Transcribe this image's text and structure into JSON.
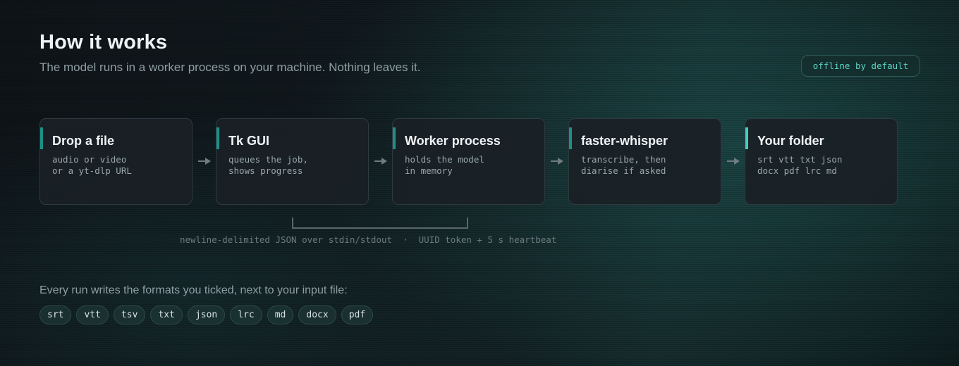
{
  "header": {
    "title": "How it works",
    "subtitle": "The model runs in a worker process on your machine. Nothing leaves it.",
    "badge": "offline by default"
  },
  "pipeline": {
    "steps": [
      {
        "title": "Drop a file",
        "description": "audio or video\nor a yt-dlp URL"
      },
      {
        "title": "Tk GUI",
        "description": "queues the job,\nshows progress"
      },
      {
        "title": "Worker process",
        "description": "holds the model\nin memory"
      },
      {
        "title": "faster-whisper",
        "description": "transcribe, then\ndiarise if asked"
      },
      {
        "title": "Your folder",
        "description": "srt vtt txt json\ndocx pdf lrc md"
      }
    ],
    "connector_icon": "arrow-right-icon",
    "protocol_note": "newline-delimited JSON over stdin/stdout  ·  UUID token + 5 s heartbeat"
  },
  "formats": {
    "intro": "Every run writes the formats you ticked, next to your input file:",
    "items": [
      "srt",
      "vtt",
      "tsv",
      "txt",
      "json",
      "lrc",
      "md",
      "docx",
      "pdf"
    ]
  },
  "colors": {
    "accent": "#1f8f86",
    "accent_bright": "#3fd0c2",
    "badge_text": "#5fd3c4"
  }
}
